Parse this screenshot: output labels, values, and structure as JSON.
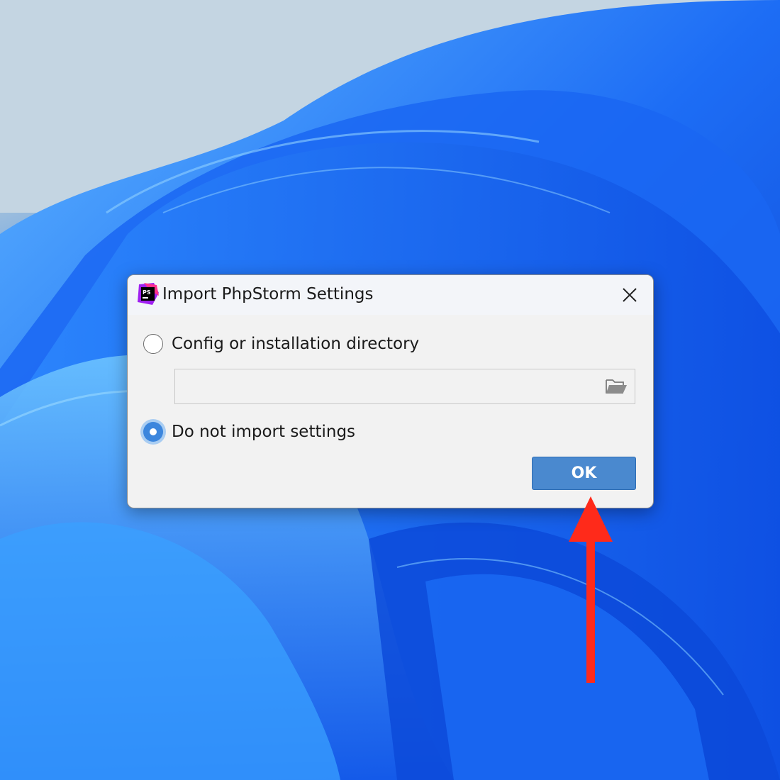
{
  "dialog": {
    "title": "Import PhpStorm Settings",
    "app_icon_text": "PS",
    "options": [
      {
        "label": "Config or installation directory",
        "selected": false
      },
      {
        "label": "Do not import settings",
        "selected": true
      }
    ],
    "path_field": {
      "value": "",
      "placeholder": ""
    },
    "ok_label": "OK"
  },
  "colors": {
    "accent": "#4a89cf",
    "radio_selected": "#3c86dd",
    "annotation_arrow": "#ff2a1a"
  },
  "icons": {
    "app": "phpstorm-logo-icon",
    "close": "close-icon",
    "browse": "folder-open-icon",
    "annotation": "red-arrow-up-icon"
  }
}
